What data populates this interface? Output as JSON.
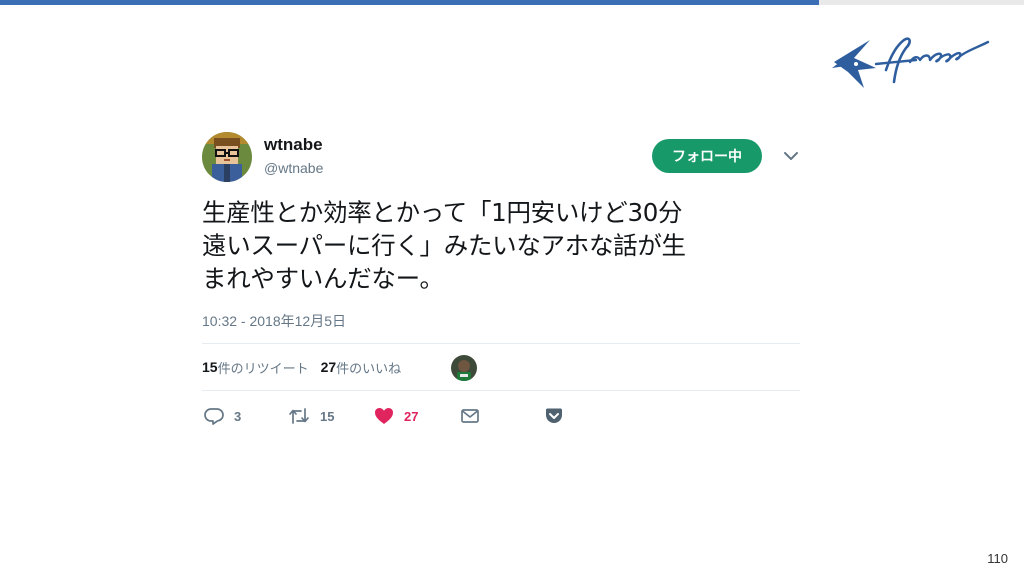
{
  "slide": {
    "progress_fraction": 0.8,
    "progress_color": "#3a6fb5",
    "page_number": "110",
    "logo_text": "freee"
  },
  "tweet": {
    "display_name": "wtnabe",
    "handle": "@wtnabe",
    "follow_label": "フォロー中",
    "follow_color": "#18996a",
    "text_lines": [
      "生産性とか効率とかって「1円安いけど30分",
      "遠いスーパーに行く」みたいなアホな話が生",
      "まれやすいんだなー。"
    ],
    "timestamp": "10:32 - 2018年12月5日",
    "stats": {
      "retweets_count": "15",
      "retweets_label": "件のリツイート",
      "likes_count": "27",
      "likes_label": "件のいいね"
    },
    "actions": {
      "replies": "3",
      "retweets": "15",
      "likes": "27"
    },
    "icons": [
      "reply-icon",
      "retweet-icon",
      "heart-icon",
      "envelope-icon",
      "pocket-icon",
      "chevron-down-icon"
    ],
    "like_color": "#e0245e"
  }
}
